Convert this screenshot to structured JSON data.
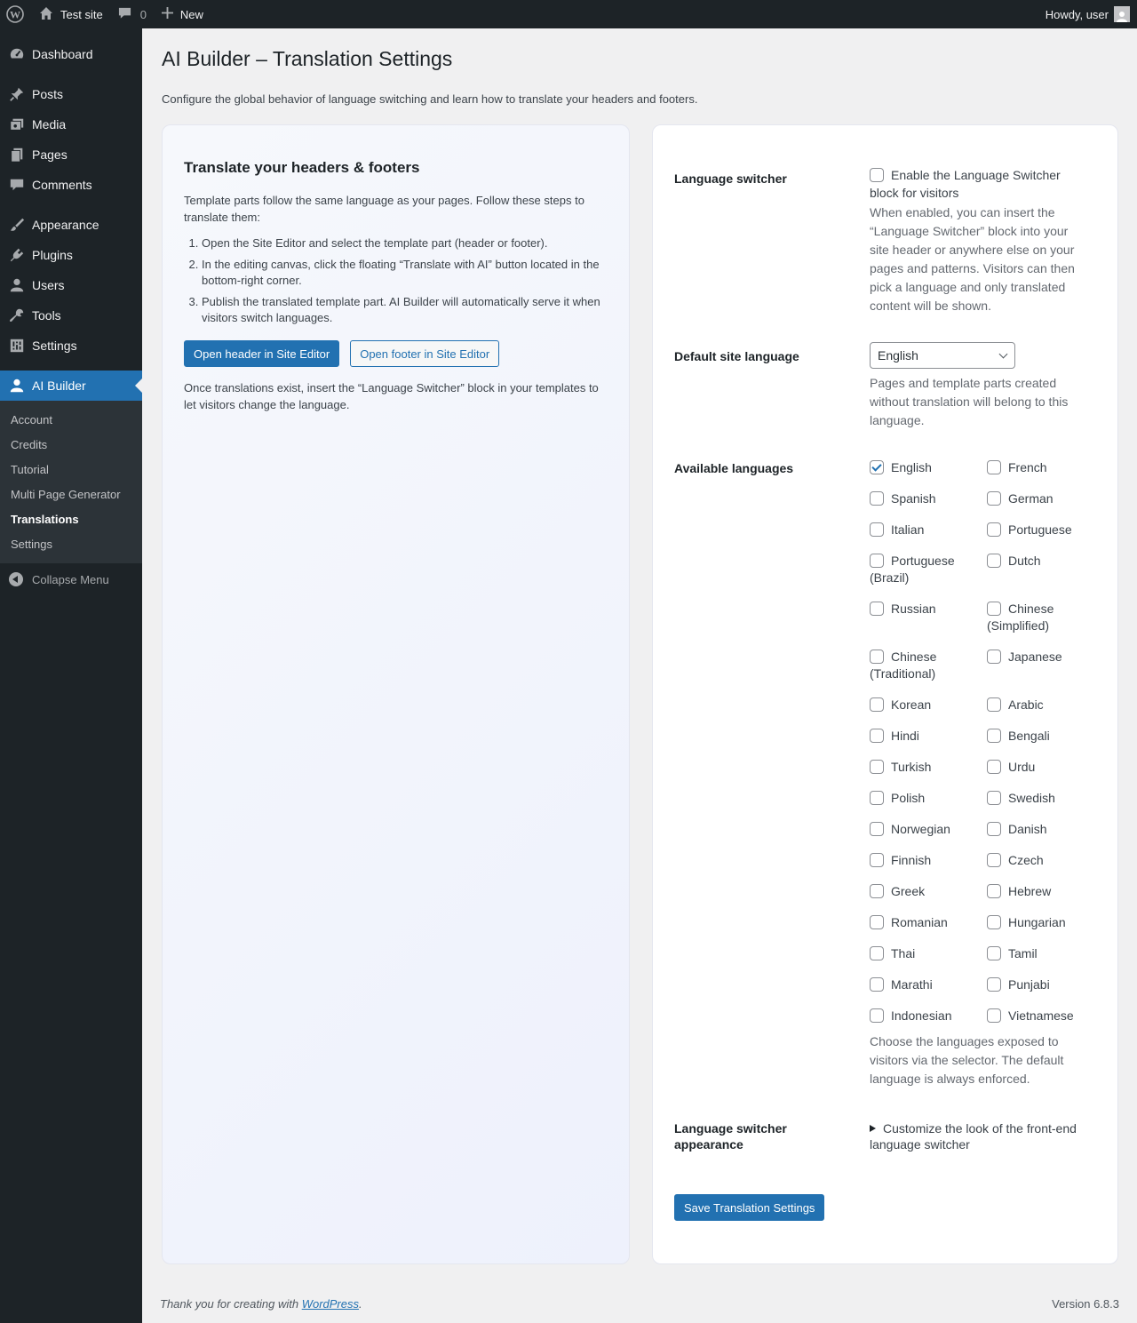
{
  "adminbar": {
    "site_name": "Test site",
    "comments_count": "0",
    "new_label": "New",
    "greeting": "Howdy, user"
  },
  "sidebar": {
    "items": [
      {
        "label": "Dashboard",
        "icon": "dashboard-icon"
      },
      {
        "label": "Posts",
        "icon": "pin-icon"
      },
      {
        "label": "Media",
        "icon": "media-icon"
      },
      {
        "label": "Pages",
        "icon": "pages-icon"
      },
      {
        "label": "Comments",
        "icon": "comment-icon"
      },
      {
        "label": "Appearance",
        "icon": "paintbrush-icon"
      },
      {
        "label": "Plugins",
        "icon": "plugin-icon"
      },
      {
        "label": "Users",
        "icon": "users-icon"
      },
      {
        "label": "Tools",
        "icon": "wrench-icon"
      },
      {
        "label": "Settings",
        "icon": "settings-icon"
      },
      {
        "label": "AI Builder",
        "icon": "user-icon"
      }
    ],
    "submenu": [
      "Account",
      "Credits",
      "Tutorial",
      "Multi Page Generator",
      "Translations",
      "Settings"
    ],
    "collapse_label": "Collapse Menu"
  },
  "page": {
    "title": "AI Builder – Translation Settings",
    "description": "Configure the global behavior of language switching and learn how to translate your headers and footers."
  },
  "left_panel": {
    "heading": "Translate your headers & footers",
    "intro": "Template parts follow the same language as your pages. Follow these steps to translate them:",
    "steps": [
      "Open the Site Editor and select the template part (header or footer).",
      "In the editing canvas, click the floating “Translate with AI” button located in the bottom-right corner.",
      "Publish the translated template part. AI Builder will automatically serve it when visitors switch languages."
    ],
    "btn_header": "Open header in Site Editor",
    "btn_footer": "Open footer in Site Editor",
    "outro": "Once translations exist, insert the “Language Switcher” block in your templates to let visitors change the language."
  },
  "right_panel": {
    "switcher_label": "Language switcher",
    "switcher_checkbox": "Enable the Language Switcher block for visitors",
    "switcher_help": "When enabled, you can insert the “Language Switcher” block into your site header or anywhere else on your pages and patterns. Visitors can then pick a language and only translated content will be shown.",
    "default_label": "Default site language",
    "default_value": "English",
    "default_help": "Pages and template parts created without translation will belong to this language.",
    "available_label": "Available languages",
    "languages": [
      {
        "name": "English",
        "checked": true
      },
      {
        "name": "French",
        "checked": false
      },
      {
        "name": "Spanish",
        "checked": false
      },
      {
        "name": "German",
        "checked": false
      },
      {
        "name": "Italian",
        "checked": false
      },
      {
        "name": "Portuguese",
        "checked": false
      },
      {
        "name": "Portuguese (Brazil)",
        "checked": false
      },
      {
        "name": "Dutch",
        "checked": false
      },
      {
        "name": "Russian",
        "checked": false
      },
      {
        "name": "Chinese (Simplified)",
        "checked": false
      },
      {
        "name": "Chinese (Traditional)",
        "checked": false
      },
      {
        "name": "Japanese",
        "checked": false
      },
      {
        "name": "Korean",
        "checked": false
      },
      {
        "name": "Arabic",
        "checked": false
      },
      {
        "name": "Hindi",
        "checked": false
      },
      {
        "name": "Bengali",
        "checked": false
      },
      {
        "name": "Turkish",
        "checked": false
      },
      {
        "name": "Urdu",
        "checked": false
      },
      {
        "name": "Polish",
        "checked": false
      },
      {
        "name": "Swedish",
        "checked": false
      },
      {
        "name": "Norwegian",
        "checked": false
      },
      {
        "name": "Danish",
        "checked": false
      },
      {
        "name": "Finnish",
        "checked": false
      },
      {
        "name": "Czech",
        "checked": false
      },
      {
        "name": "Greek",
        "checked": false
      },
      {
        "name": "Hebrew",
        "checked": false
      },
      {
        "name": "Romanian",
        "checked": false
      },
      {
        "name": "Hungarian",
        "checked": false
      },
      {
        "name": "Thai",
        "checked": false
      },
      {
        "name": "Tamil",
        "checked": false
      },
      {
        "name": "Marathi",
        "checked": false
      },
      {
        "name": "Punjabi",
        "checked": false
      },
      {
        "name": "Indonesian",
        "checked": false
      },
      {
        "name": "Vietnamese",
        "checked": false
      }
    ],
    "available_help": "Choose the languages exposed to visitors via the selector. The default language is always enforced.",
    "appearance_label": "Language switcher appearance",
    "appearance_toggle": "Customize the look of the front-end language switcher",
    "save_label": "Save Translation Settings"
  },
  "footer": {
    "thanks_prefix": "Thank you for creating with ",
    "link_text": "WordPress",
    "thanks_suffix": ".",
    "version": "Version 6.8.3"
  },
  "colors": {
    "accent": "#2271b1",
    "admin_dark": "#1d2327"
  }
}
